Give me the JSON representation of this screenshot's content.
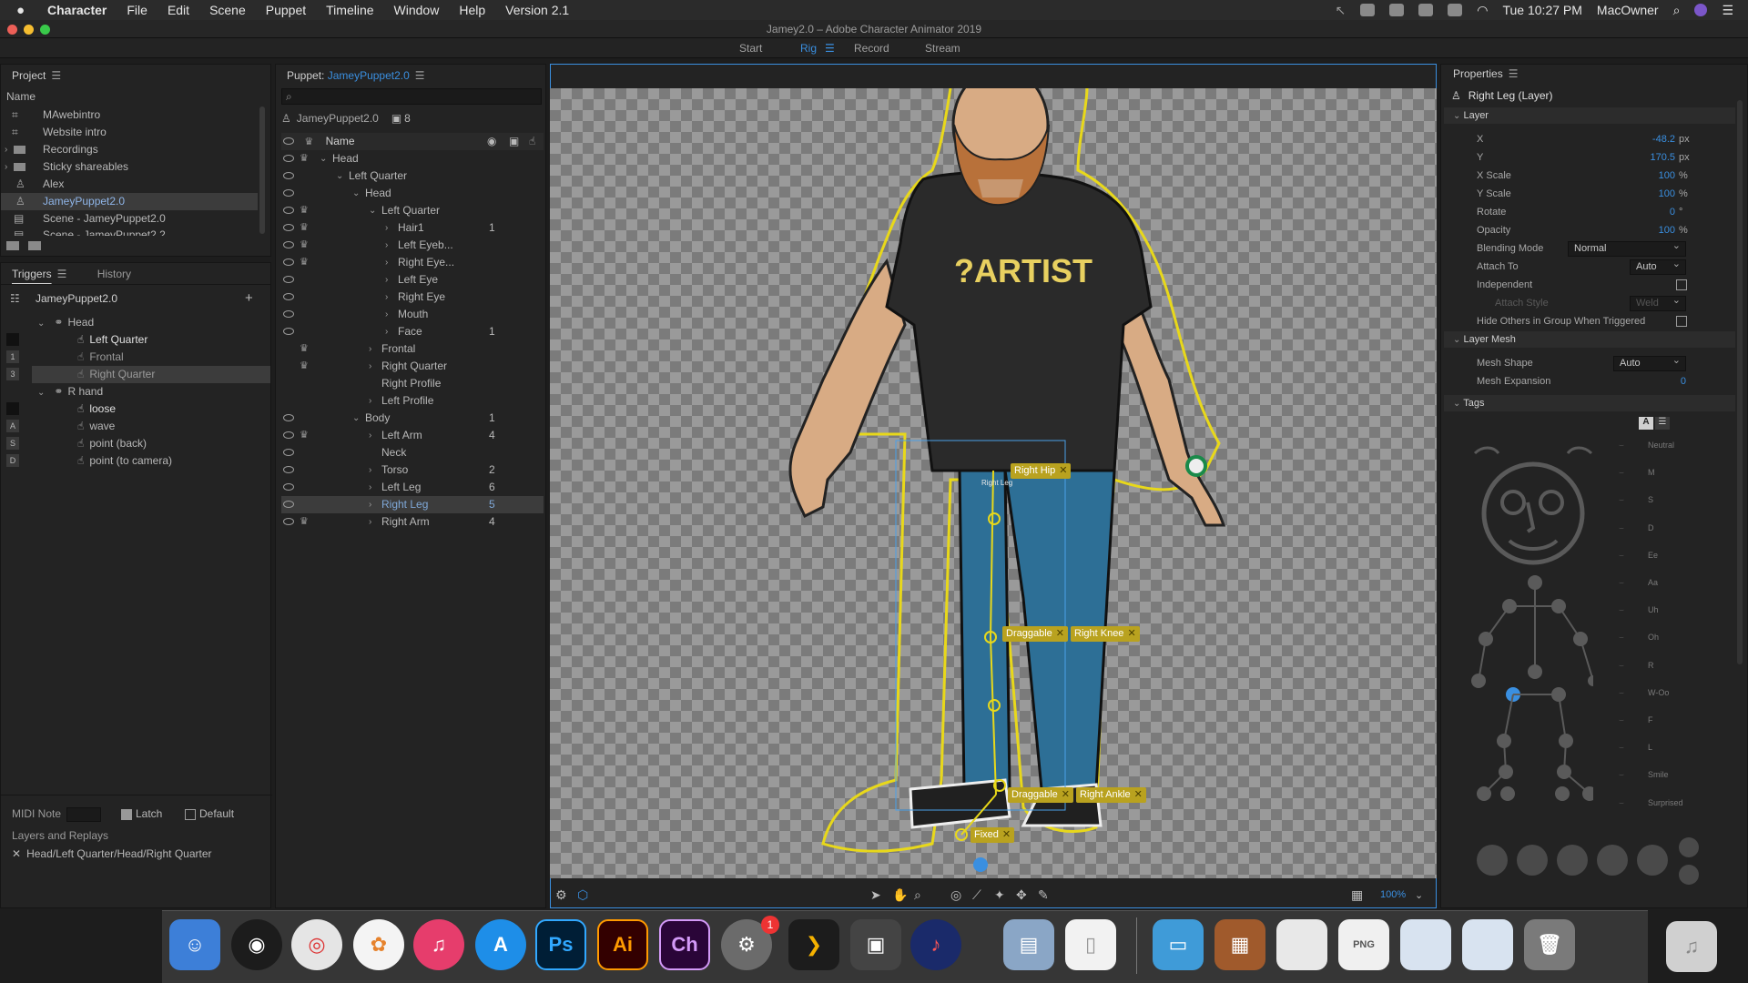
{
  "menubar": {
    "app": "Character",
    "items": [
      "File",
      "Edit",
      "Scene",
      "Puppet",
      "Timeline",
      "Window",
      "Help",
      "Version 2.1"
    ],
    "clock": "Tue 10:27 PM",
    "user": "MacOwner"
  },
  "window": {
    "title": "Jamey2.0 – Adobe Character Animator 2019",
    "modes": [
      "Start",
      "Rig",
      "Record",
      "Stream"
    ],
    "active_mode": "Rig"
  },
  "project": {
    "title": "Project",
    "col_header": "Name",
    "items": [
      "MAwebintro",
      "Website intro",
      "Recordings",
      "Sticky shareables",
      "Alex",
      "JameyPuppet2.0",
      "Scene - JameyPuppet2.0",
      "Scene - JameyPuppet2.2"
    ]
  },
  "triggers": {
    "tab_triggers": "Triggers",
    "tab_history": "History",
    "puppet": "JameyPuppet2.0",
    "rows": [
      {
        "key": "",
        "label": "Head"
      },
      {
        "key": "",
        "label": "Left Quarter"
      },
      {
        "key": "1",
        "label": "Frontal"
      },
      {
        "key": "3",
        "label": "Right Quarter"
      },
      {
        "key": "",
        "label": "R hand"
      },
      {
        "key": "",
        "label": "loose"
      },
      {
        "key": "A",
        "label": "wave"
      },
      {
        "key": "S",
        "label": "point (back)"
      },
      {
        "key": "D",
        "label": "point (to camera)"
      }
    ],
    "midi_label": "MIDI Note",
    "latch_label": "Latch",
    "default_label": "Default",
    "layers_replays": "Layers and Replays",
    "layer_path": "Head/Left Quarter/Head/Right Quarter"
  },
  "puppet": {
    "label": "Puppet:",
    "name": "JameyPuppet2.0",
    "root": "JameyPuppet2.0",
    "root_count": "8",
    "col_name": "Name",
    "layers": [
      {
        "label": "Head",
        "count": ""
      },
      {
        "label": "Left Quarter",
        "count": ""
      },
      {
        "label": "Head",
        "count": ""
      },
      {
        "label": "Left Quarter",
        "count": ""
      },
      {
        "label": "Hair1",
        "count": "1"
      },
      {
        "label": "Left Eyeb...",
        "count": ""
      },
      {
        "label": "Right Eye...",
        "count": ""
      },
      {
        "label": "Left Eye",
        "count": ""
      },
      {
        "label": "Right Eye",
        "count": ""
      },
      {
        "label": "Mouth",
        "count": ""
      },
      {
        "label": "Face",
        "count": "1"
      },
      {
        "label": "Frontal",
        "count": ""
      },
      {
        "label": "Right Quarter",
        "count": ""
      },
      {
        "label": "Right Profile",
        "count": ""
      },
      {
        "label": "Left Profile",
        "count": ""
      },
      {
        "label": "Body",
        "count": "1"
      },
      {
        "label": "Left Arm",
        "count": "4"
      },
      {
        "label": "Neck",
        "count": ""
      },
      {
        "label": "Torso",
        "count": "2"
      },
      {
        "label": "Left Leg",
        "count": "6"
      },
      {
        "label": "Right Leg",
        "count": "5"
      },
      {
        "label": "Right Arm",
        "count": "4"
      }
    ]
  },
  "canvas": {
    "shirt_text": "?ARTIST",
    "tags": {
      "right_hip": "Right Hip",
      "right_leg": "Right Leg",
      "draggable": "Draggable",
      "right_knee": "Right Knee",
      "right_ankle": "Right Ankle",
      "fixed": "Fixed"
    },
    "zoom": "100%"
  },
  "properties": {
    "title": "Properties",
    "layer_name": "Right Leg (Layer)",
    "section_layer": "Layer",
    "x_label": "X",
    "x_val": "-48.2",
    "x_unit": "px",
    "y_label": "Y",
    "y_val": "170.5",
    "y_unit": "px",
    "xs_label": "X Scale",
    "xs_val": "100",
    "xs_unit": "%",
    "ys_label": "Y Scale",
    "ys_val": "100",
    "ys_unit": "%",
    "rot_label": "Rotate",
    "rot_val": "0",
    "rot_unit": "°",
    "op_label": "Opacity",
    "op_val": "100",
    "op_unit": "%",
    "blend_label": "Blending Mode",
    "blend_val": "Normal",
    "attach_label": "Attach To",
    "attach_val": "Auto",
    "indep_label": "Independent",
    "attach_style_label": "Attach Style",
    "attach_style_val": "Weld",
    "hide_label": "Hide Others in Group When Triggered",
    "section_mesh": "Layer Mesh",
    "mesh_shape_label": "Mesh Shape",
    "mesh_shape_val": "Auto",
    "mesh_exp_label": "Mesh Expansion",
    "mesh_exp_val": "0",
    "section_tags": "Tags",
    "visemes": [
      "Neutral",
      "M",
      "S",
      "D",
      "Ee",
      "Aa",
      "Uh",
      "Oh",
      "R",
      "W-Oo",
      "F",
      "L",
      "Smile",
      "Surprised"
    ]
  },
  "dock": {
    "ps": "Ps",
    "ai": "Ai",
    "ch": "Ch",
    "badge": "1",
    "png": "PNG"
  }
}
